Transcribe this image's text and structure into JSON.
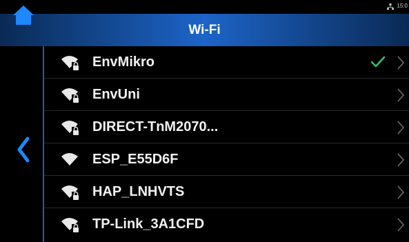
{
  "status": {
    "time": "15:0",
    "network_icon": "network-icon"
  },
  "header": {
    "title": "Wi-Fi",
    "home_icon": "home-icon"
  },
  "nav": {
    "back_icon": "back-chevron-icon"
  },
  "networks": [
    {
      "ssid": "EnvMikro",
      "secured": true,
      "connected": true
    },
    {
      "ssid": "EnvUni",
      "secured": true,
      "connected": false
    },
    {
      "ssid": "DIRECT-TnM2070...",
      "secured": true,
      "connected": false
    },
    {
      "ssid": "ESP_E55D6F",
      "secured": false,
      "connected": false
    },
    {
      "ssid": "HAP_LNHVTS",
      "secured": true,
      "connected": false
    },
    {
      "ssid": "TP-Link_3A1CFD",
      "secured": true,
      "connected": false
    }
  ],
  "colors": {
    "header_center": "#1d64c8",
    "header_edge": "#0a2a55",
    "accent_blue": "#1e88ff",
    "check_green": "#35c46a",
    "text": "#f2f2f2"
  }
}
